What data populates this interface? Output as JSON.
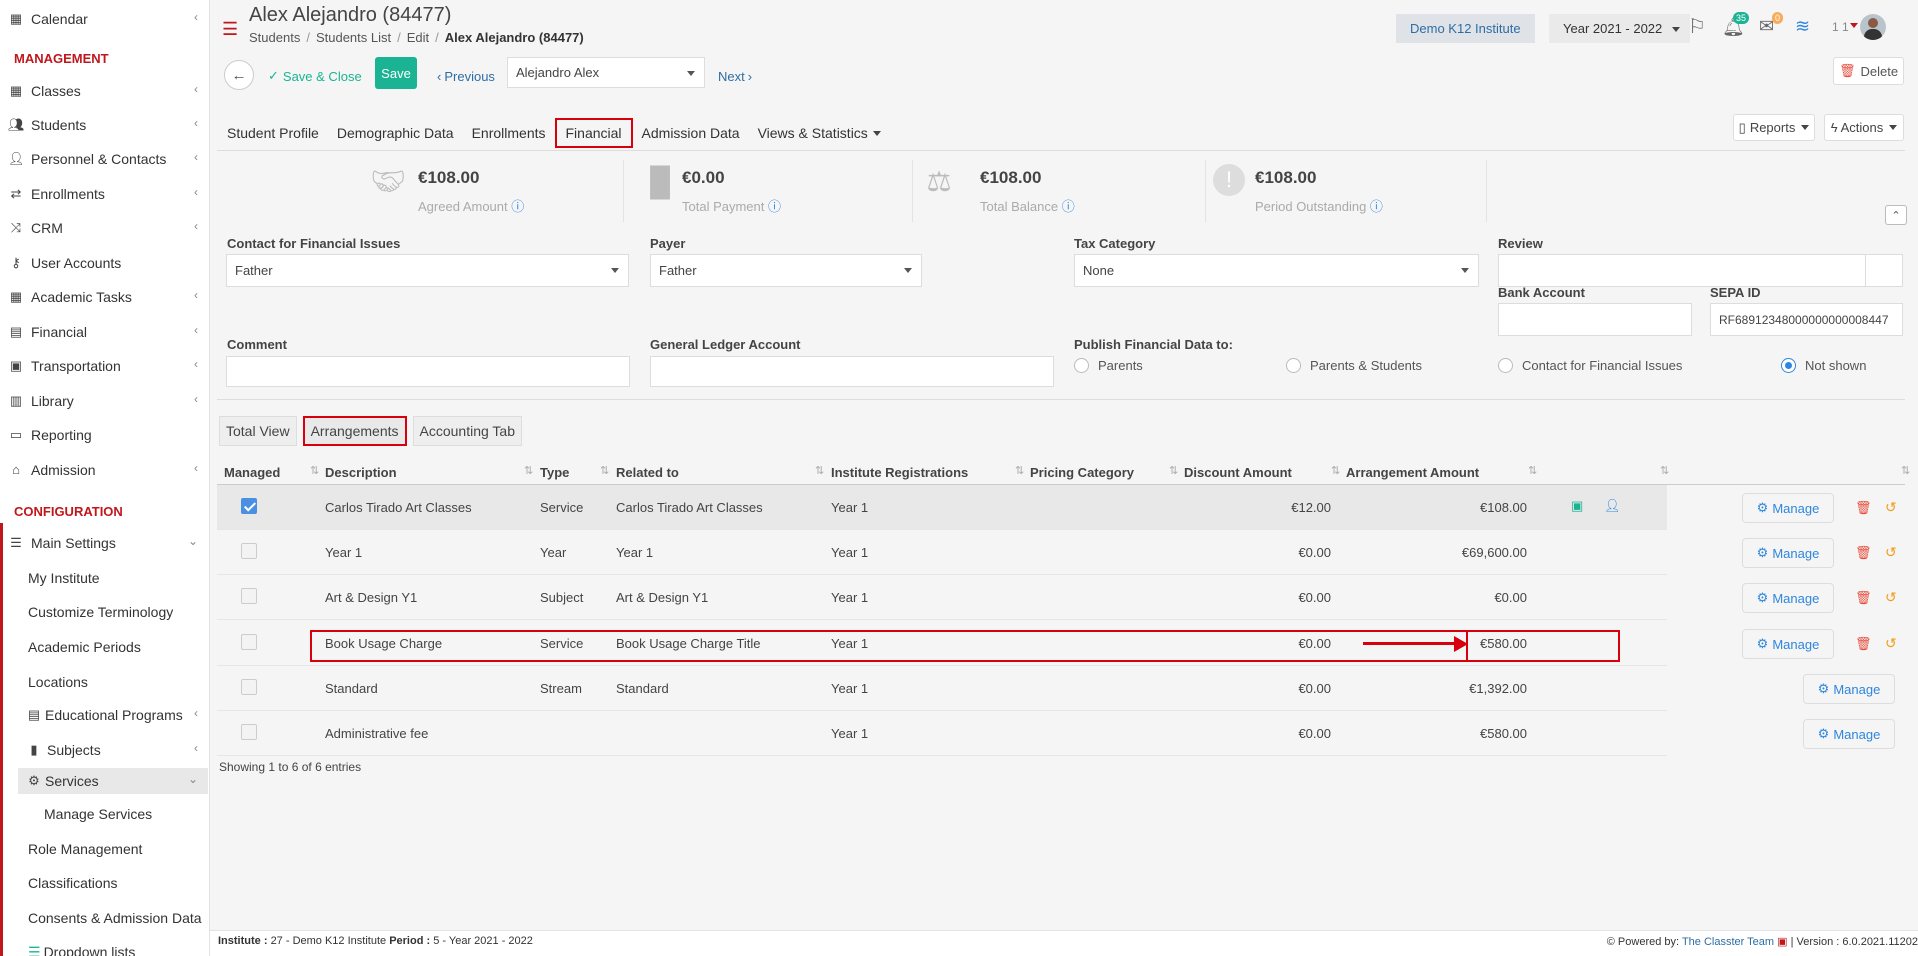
{
  "sidebar": {
    "calendar": "Calendar",
    "management_header": "MANAGEMENT",
    "management": [
      {
        "label": "Classes",
        "icon": "classes-icon",
        "chevron": "‹"
      },
      {
        "label": "Students",
        "icon": "students-icon",
        "chevron": "‹"
      },
      {
        "label": "Personnel & Contacts",
        "icon": "personnel-icon",
        "chevron": "‹"
      },
      {
        "label": "Enrollments",
        "icon": "enrollments-icon",
        "chevron": "‹"
      },
      {
        "label": "CRM",
        "icon": "crm-icon",
        "chevron": "‹"
      },
      {
        "label": "User Accounts",
        "icon": "key-icon",
        "chevron": ""
      },
      {
        "label": "Academic Tasks",
        "icon": "tasks-icon",
        "chevron": "‹"
      },
      {
        "label": "Financial",
        "icon": "money-icon",
        "chevron": "‹"
      },
      {
        "label": "Transportation",
        "icon": "bus-icon",
        "chevron": "‹"
      },
      {
        "label": "Library",
        "icon": "library-icon",
        "chevron": "‹"
      },
      {
        "label": "Reporting",
        "icon": "print-icon",
        "chevron": ""
      },
      {
        "label": "Admission",
        "icon": "bank-icon",
        "chevron": "‹"
      }
    ],
    "configuration_header": "CONFIGURATION",
    "main_settings": "Main Settings",
    "sub": [
      "My Institute",
      "Customize Terminology",
      "Academic Periods",
      "Locations"
    ],
    "educational_programs": "Educational Programs",
    "subjects": "Subjects",
    "services": "Services",
    "manage_services": "Manage Services",
    "sub2": [
      "Role Management",
      "Classifications",
      "Consents & Admission Data"
    ],
    "dropdown_lists": "Dropdown lists"
  },
  "header": {
    "title": "Alex Alejandro (84477)",
    "breadcrumb": [
      "Students",
      "Students List",
      "Edit",
      "Alex Alejandro (84477)"
    ],
    "institute": "Demo K12 Institute",
    "year": "Year 2021 - 2022",
    "notif_count": "35",
    "msg_count": "0",
    "user_count": "1 1"
  },
  "toolbar": {
    "save_close": "Save & Close",
    "save": "Save",
    "previous": "Previous",
    "student_select": "Alejandro Alex",
    "next": "Next",
    "delete": "Delete"
  },
  "tabs": [
    "Student Profile",
    "Demographic Data",
    "Enrollments",
    "Financial",
    "Admission Data",
    "Views & Statistics"
  ],
  "reports": "Reports",
  "actions": "Actions",
  "stats": [
    {
      "value": "€108.00",
      "label": "Agreed Amount"
    },
    {
      "value": "€0.00",
      "label": "Total Payment"
    },
    {
      "value": "€108.00",
      "label": "Total Balance"
    },
    {
      "value": "€108.00",
      "label": "Period Outstanding"
    }
  ],
  "form": {
    "contact_label": "Contact for Financial Issues",
    "contact_value": "Father",
    "payer_label": "Payer",
    "payer_value": "Father",
    "tax_label": "Tax Category",
    "tax_value": "None",
    "review_label": "Review",
    "bank_label": "Bank Account",
    "sepa_label": "SEPA ID",
    "sepa_value": "RF68912348000000000008447",
    "comment_label": "Comment",
    "gl_label": "General Ledger Account",
    "publish_label": "Publish Financial Data to:",
    "publish_options": [
      "Parents",
      "Parents & Students",
      "Contact for Financial Issues",
      "Not shown"
    ]
  },
  "subtabs": [
    "Total View",
    "Arrangements",
    "Accounting Tab"
  ],
  "table": {
    "headers": [
      "Managed",
      "Description",
      "Type",
      "Related to",
      "Institute Registrations",
      "Pricing Category",
      "Discount Amount",
      "Arrangement Amount"
    ],
    "rows": [
      {
        "managed": true,
        "description": "Carlos Tirado Art Classes",
        "type": "Service",
        "related": "Carlos Tirado Art Classes",
        "registrations": "Year 1",
        "pricing": "",
        "discount": "€12.00",
        "amount": "€108.00",
        "manage": "Manage"
      },
      {
        "managed": false,
        "description": "Year 1",
        "type": "Year",
        "related": "Year 1",
        "registrations": "Year 1",
        "pricing": "",
        "discount": "€0.00",
        "amount": "€69,600.00",
        "manage": "Manage"
      },
      {
        "managed": false,
        "description": "Art & Design Y1",
        "type": "Subject",
        "related": "Art & Design Y1",
        "registrations": "Year 1",
        "pricing": "",
        "discount": "€0.00",
        "amount": "€0.00",
        "manage": "Manage"
      },
      {
        "managed": false,
        "description": "Book Usage Charge",
        "type": "Service",
        "related": "Book Usage Charge Title",
        "registrations": "Year 1",
        "pricing": "",
        "discount": "€0.00",
        "amount": "€580.00",
        "manage": "Manage"
      },
      {
        "managed": false,
        "description": "Standard",
        "type": "Stream",
        "related": "Standard",
        "registrations": "Year 1",
        "pricing": "",
        "discount": "€0.00",
        "amount": "€1,392.00",
        "manage": "Manage"
      },
      {
        "managed": false,
        "description": "Administrative fee",
        "type": "",
        "related": "",
        "registrations": "Year 1",
        "pricing": "",
        "discount": "€0.00",
        "amount": "€580.00",
        "manage": "Manage"
      }
    ],
    "showing": "Showing 1 to 6 of 6 entries"
  },
  "footer": {
    "institute_label": "Institute :",
    "institute_value": "27 - Demo K12 Institute",
    "period_label": "Period :",
    "period_value": "5 - Year 2021 - 2022",
    "powered": "Powered by:",
    "team": "The Classter Team",
    "version": "| Version : 6.0.2021.11202"
  },
  "colors": {
    "accent": "#c0171d",
    "save": "#1ab394",
    "link": "#2e86de",
    "highlight": "#d8000c"
  }
}
